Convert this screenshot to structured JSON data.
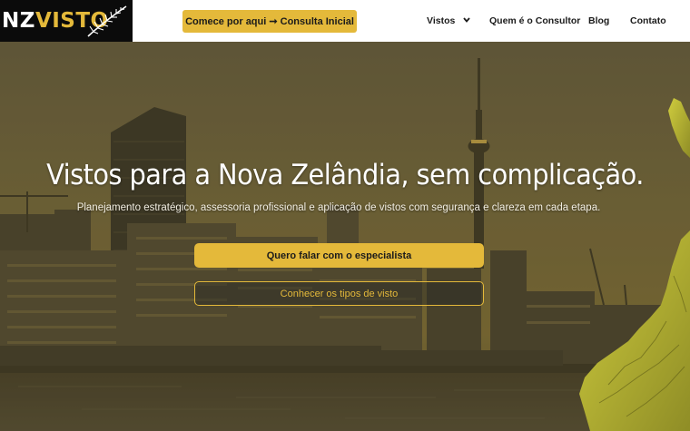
{
  "brand": {
    "logo_part1": "NZ",
    "logo_part2": "VISTO"
  },
  "header": {
    "cta_label": "Comece por aqui ➞ Consulta Inicial",
    "nav": [
      {
        "label": "Vistos",
        "has_dropdown": true
      },
      {
        "label": "Quem é o Consultor"
      },
      {
        "label": "Blog"
      },
      {
        "label": "Contato"
      }
    ]
  },
  "hero": {
    "title": "Vistos para a Nova Zelândia, sem complicação.",
    "subtitle": "Planejamento estratégico, assessoria profissional e aplicação de vistos com segurança e clareza em cada etapa.",
    "primary_button": "Quero falar com o especialista",
    "secondary_button": "Conhecer os tipos de visto"
  },
  "colors": {
    "accent": "#e4b93a",
    "header_bg": "#ffffff",
    "logo_bg": "#0b0b0b",
    "text_dark": "#1b1b1b"
  },
  "icons": [
    "silver-fern-icon",
    "chevron-down-icon",
    "new-zealand-map-icon"
  ]
}
